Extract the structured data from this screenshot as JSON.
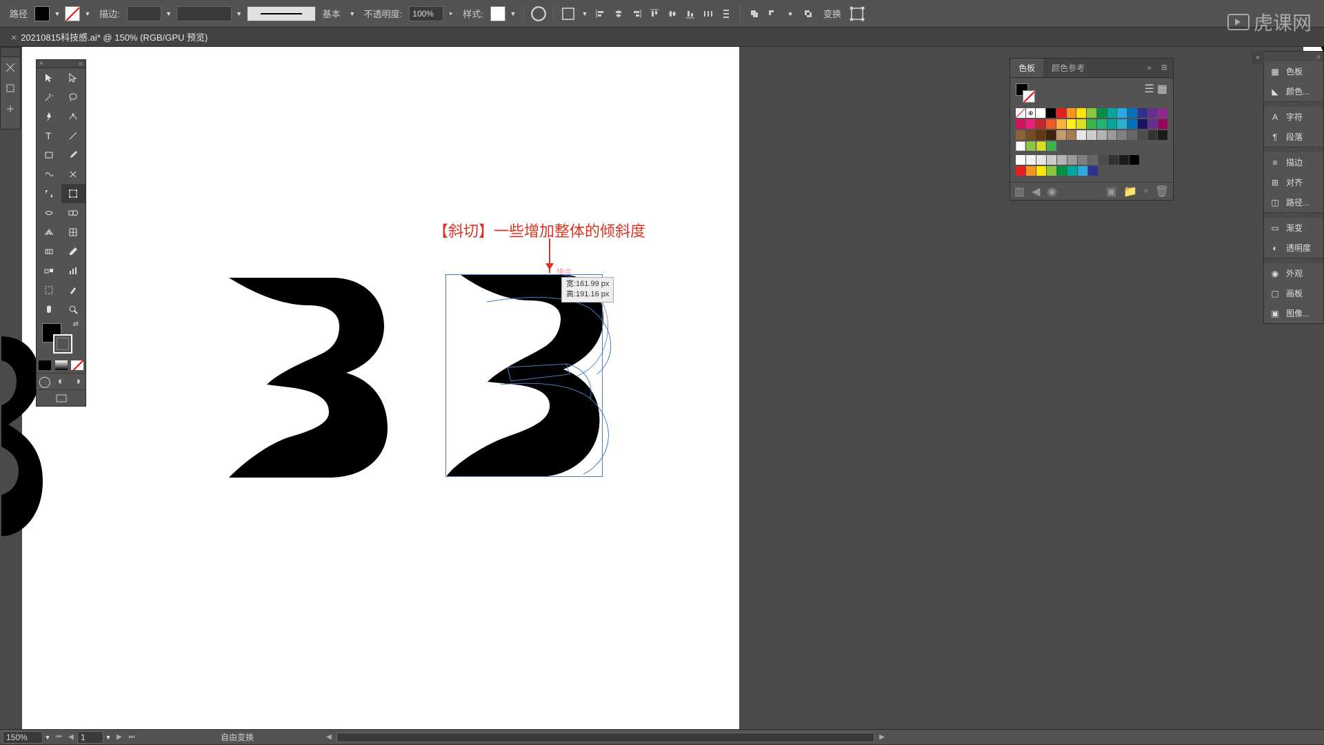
{
  "options": {
    "path_label": "路径",
    "stroke_label": "描边:",
    "profile_label": "基本",
    "opacity_label": "不透明度:",
    "opacity_value": "100%",
    "style_label": "样式:",
    "transform_label": "变换"
  },
  "doc_tab": {
    "title": "20210815科技感.ai* @ 150% (RGB/GPU 预览)"
  },
  "swatch_panel": {
    "tab1": "色板",
    "tab2": "颜色参考",
    "colors_row1": [
      "#ffffff",
      "#000000",
      "#e81e1e",
      "#f7931e",
      "#ffe600",
      "#8cc63f",
      "#009245",
      "#00a99d",
      "#29abe2",
      "#0071bc",
      "#2e3192",
      "#662d91",
      "#93278f",
      "#d4145a",
      "#ed1e79",
      "#c1272d",
      "#f15a24"
    ],
    "colors_row2": [
      "#fbb03b",
      "#fcee21",
      "#d9e021",
      "#39b54a",
      "#22b573",
      "#00a99d",
      "#2bb0c9",
      "#0071bc",
      "#1b1464",
      "#662d91",
      "#9e005d",
      "#8c6239",
      "#754c24",
      "#603813",
      "#42210b",
      "#c69c6d",
      "#a67c52"
    ],
    "colors_row3": [
      "#e6e6e6",
      "#cccccc",
      "#b3b3b3",
      "#999999",
      "#808080",
      "#666666",
      "#4d4d4d",
      "#333333",
      "#1a1a1a",
      "#534741",
      "#736357",
      "#998675",
      "#c7b299",
      "#8cc63f",
      "#d9e021",
      "#006837",
      "#39b54a"
    ],
    "colors_grey": [
      "#ffffff",
      "#f2f2f2",
      "#e6e6e6",
      "#cccccc",
      "#b3b3b3",
      "#999999",
      "#808080",
      "#666666",
      "#4d4d4d",
      "#333333",
      "#1a1a1a",
      "#000000"
    ],
    "colors_row5": [
      "#e81e1e",
      "#f7931e",
      "#ffe600",
      "#8cc63f",
      "#009245",
      "#00a99d",
      "#29abe2",
      "#2e3192"
    ]
  },
  "right_strip": {
    "items1": [
      "色板",
      "颜色..."
    ],
    "items2": [
      "字符",
      "段落"
    ],
    "items3": [
      "描边",
      "对齐",
      "路径..."
    ],
    "items4": [
      "渐变",
      "透明度"
    ],
    "items5": [
      "外观",
      "画板",
      "图像..."
    ]
  },
  "annotation": {
    "text": "【斜切】一些增加整体的倾斜度",
    "pink": "接点"
  },
  "tooltip": {
    "w_label": "宽",
    "w_value": ":161.99 px",
    "h_label": "高",
    "h_value": ":191.16 px"
  },
  "status": {
    "zoom": "150%",
    "artboard": "1",
    "mode": "自由变换"
  },
  "watermark": "虎课网"
}
